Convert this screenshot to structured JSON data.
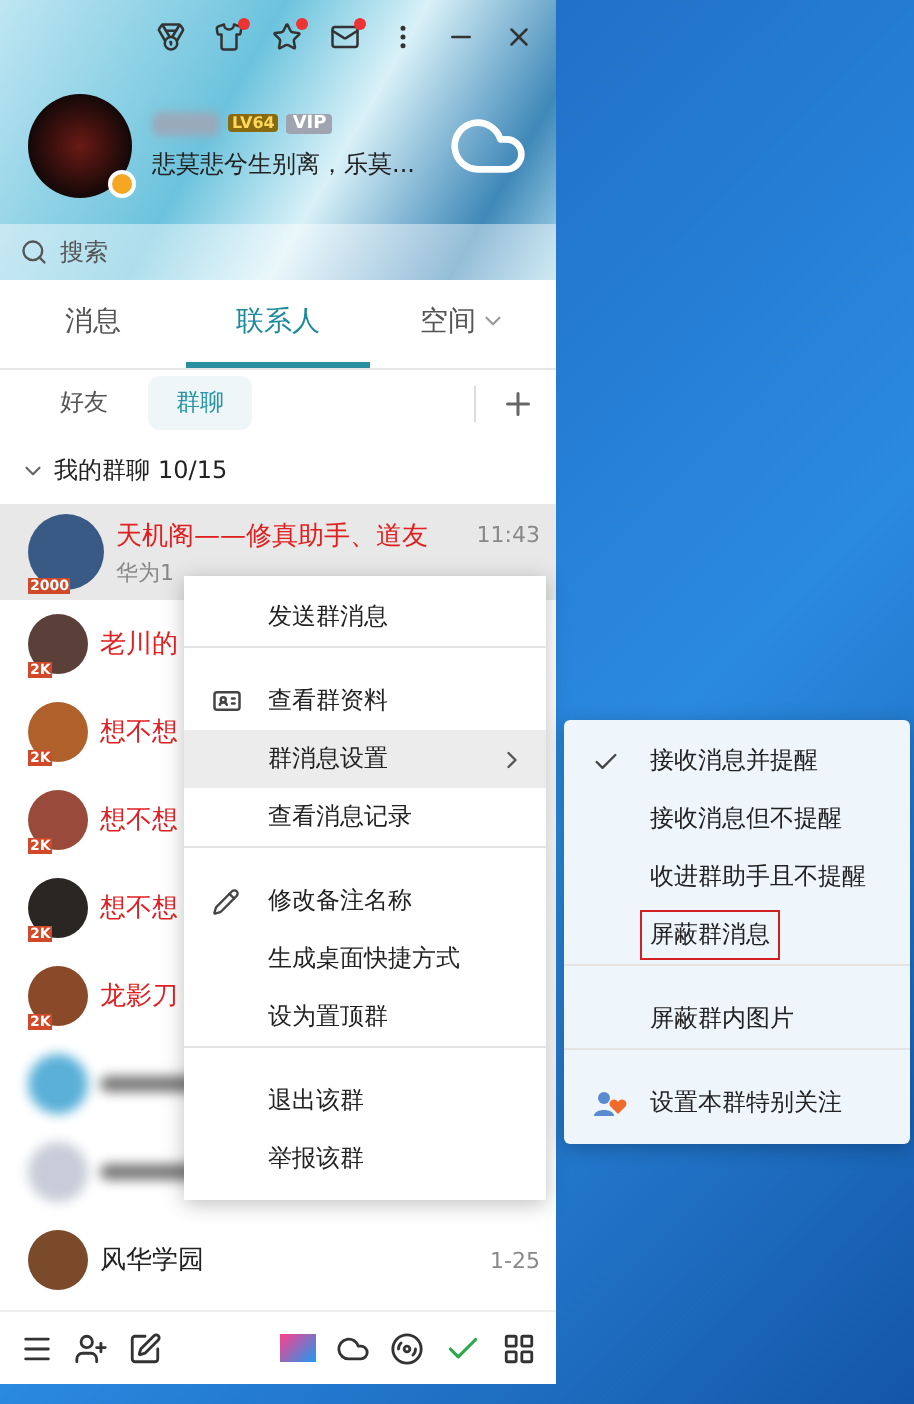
{
  "title_bar": {
    "icons": [
      {
        "kind": "medal",
        "dot": false
      },
      {
        "kind": "shirt",
        "dot": true
      },
      {
        "kind": "star",
        "dot": true
      },
      {
        "kind": "mail",
        "dot": true
      }
    ]
  },
  "profile": {
    "level_badge": "LV64",
    "vip_badge": "VIP",
    "signature": "悲莫悲兮生别离，乐莫..."
  },
  "search": {
    "placeholder": "搜索"
  },
  "tabs": [
    {
      "label": "消息",
      "selected": false,
      "dropdown": false
    },
    {
      "label": "联系人",
      "selected": true,
      "dropdown": false
    },
    {
      "label": "空间",
      "selected": false,
      "dropdown": true
    }
  ],
  "subtabs": [
    {
      "label": "好友",
      "selected": false
    },
    {
      "label": "群聊",
      "selected": true
    }
  ],
  "group_header": {
    "expanded": true,
    "title": "我的群聊",
    "count": "10/15"
  },
  "groups": [
    {
      "kind": "group",
      "name": "天机阁——修真助手、道友",
      "time": "11:43",
      "preview": "华为1",
      "badge": "2000",
      "selected": true,
      "special": true
    },
    {
      "kind": "group",
      "name": "老川的",
      "badge": "2K",
      "selected": false,
      "special": true
    },
    {
      "kind": "group",
      "name": "想不想",
      "badge": "2K",
      "selected": false,
      "special": true
    },
    {
      "kind": "group",
      "name": "想不想",
      "badge": "2K",
      "selected": false,
      "special": true
    },
    {
      "kind": "group",
      "name": "想不想",
      "badge": "2K",
      "selected": false,
      "special": true
    },
    {
      "kind": "group",
      "name": "龙影刀",
      "badge": "2K",
      "selected": false,
      "special": true
    },
    {
      "kind": "blurred",
      "selected": false
    },
    {
      "kind": "blurred",
      "selected": false
    },
    {
      "kind": "group",
      "name": "风华学园",
      "time": "1-25",
      "selected": false,
      "special": false
    }
  ],
  "context_menu": {
    "items": [
      {
        "kind": "plain",
        "label": "发送群消息",
        "submenu": false,
        "highlighted": false,
        "divider_before": false
      },
      {
        "kind": "card",
        "label": "查看群资料",
        "submenu": false,
        "highlighted": false,
        "divider_before": true
      },
      {
        "kind": "plain",
        "label": "群消息设置",
        "submenu": true,
        "highlighted": true,
        "divider_before": false
      },
      {
        "kind": "plain",
        "label": "查看消息记录",
        "submenu": false,
        "highlighted": false,
        "divider_before": false
      },
      {
        "kind": "pencil",
        "label": "修改备注名称",
        "submenu": false,
        "highlighted": false,
        "divider_before": true
      },
      {
        "kind": "plain",
        "label": "生成桌面快捷方式",
        "submenu": false,
        "highlighted": false,
        "divider_before": false
      },
      {
        "kind": "plain",
        "label": "设为置顶群",
        "submenu": false,
        "highlighted": false,
        "divider_before": false
      },
      {
        "kind": "plain",
        "label": "退出该群",
        "submenu": false,
        "highlighted": false,
        "divider_before": true
      },
      {
        "kind": "plain",
        "label": "举报该群",
        "submenu": false,
        "highlighted": false,
        "divider_before": false
      }
    ]
  },
  "submenu": {
    "items": [
      {
        "kind": "plain",
        "label": "接收消息并提醒",
        "checked": true,
        "outlined": false,
        "divider_before": false
      },
      {
        "kind": "plain",
        "label": "接收消息但不提醒",
        "checked": false,
        "outlined": false,
        "divider_before": false
      },
      {
        "kind": "plain",
        "label": "收进群助手且不提醒",
        "checked": false,
        "outlined": false,
        "divider_before": false
      },
      {
        "kind": "plain",
        "label": "屏蔽群消息",
        "checked": false,
        "outlined": true,
        "divider_before": false
      },
      {
        "kind": "plain",
        "label": "屏蔽群内图片",
        "checked": false,
        "outlined": false,
        "divider_before": true
      },
      {
        "kind": "heart",
        "label": "设置本群特别关注",
        "checked": false,
        "outlined": false,
        "divider_before": true
      }
    ]
  }
}
